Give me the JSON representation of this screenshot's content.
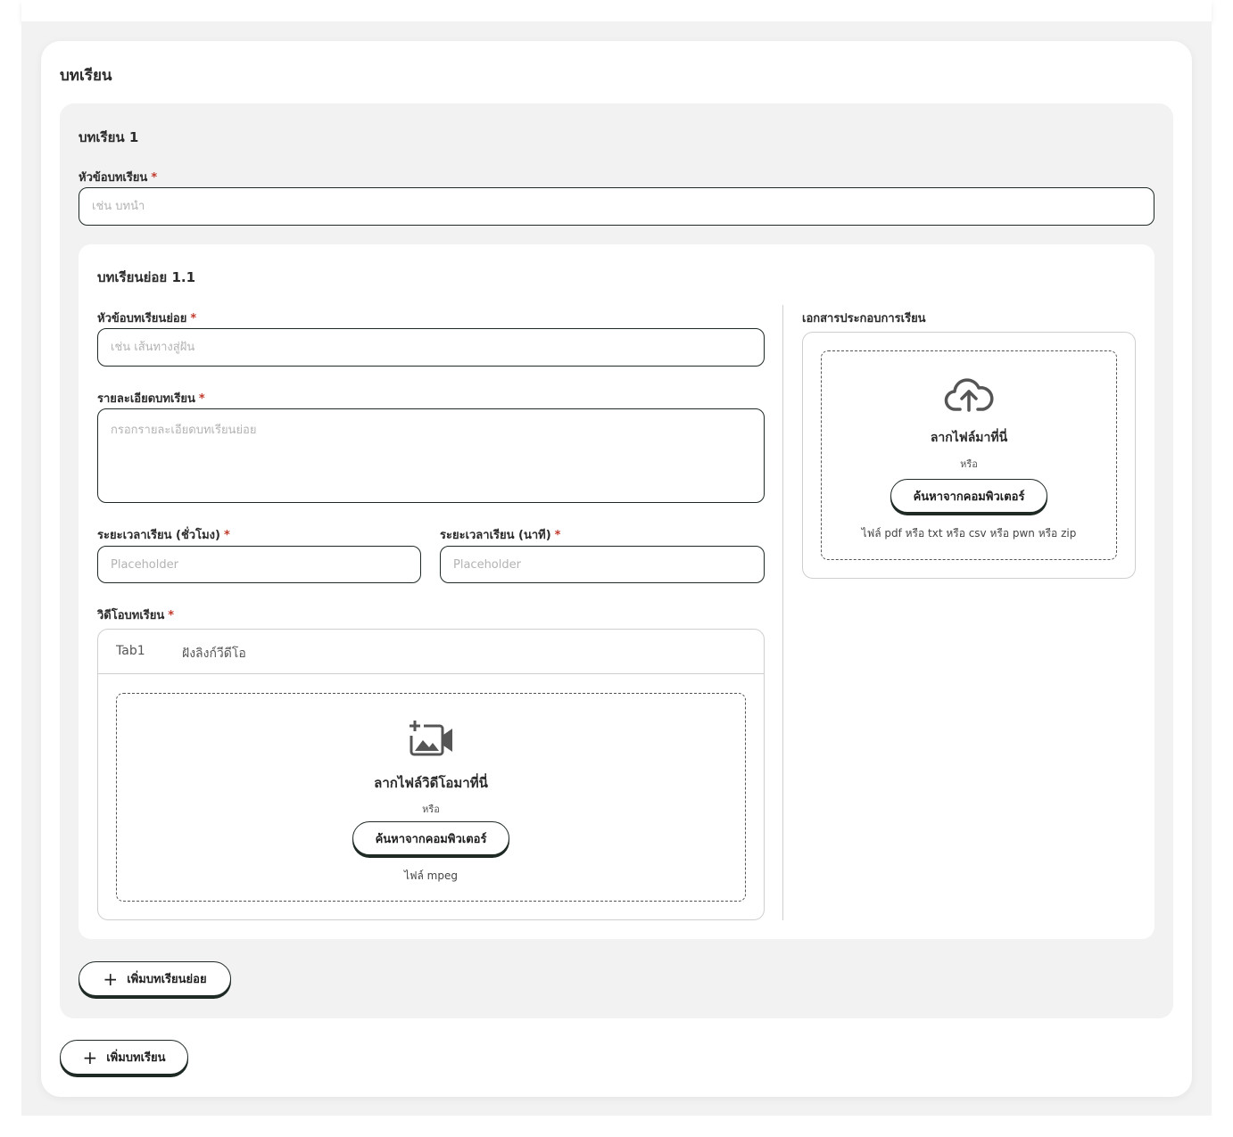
{
  "section": {
    "title": "บทเรียน"
  },
  "lesson": {
    "title": "บทเรียน 1",
    "topic_label": "หัวข้อบทเรียน",
    "topic_placeholder": "เช่น บทนำ",
    "required_mark": "*"
  },
  "sublesson": {
    "title": "บทเรียนย่อย 1.1",
    "topic_label": "หัวข้อบทเรียนย่อย",
    "topic_placeholder": "เช่น เส้นทางสู่ฝัน",
    "detail_label": "รายละเอียดบทเรียน",
    "detail_placeholder": "กรอกรายละเอียดบทเรียนย่อย",
    "hours_label": "ระยะเวลาเรียน (ชั่วโมง)",
    "hours_placeholder": "Placeholder",
    "minutes_label": "ระยะเวลาเรียน (นาที)",
    "minutes_placeholder": "Placeholder",
    "video_label": "วิดีโอบทเรียน",
    "video_tabs": [
      "Tab1",
      "ฝังลิงก์วีดีโอ"
    ],
    "video_drop": {
      "icon": "add-video-icon",
      "title": "ลากไฟล์วิดีโอมาที่นี่",
      "or": "หรือ",
      "browse_button": "ค้นหาจากคอมพิวเตอร์",
      "hint": "ไฟล์ mpeg"
    },
    "docs_label": "เอกสารประกอบการเรียน",
    "docs_drop": {
      "icon": "cloud-upload-icon",
      "title": "ลากไฟล์มาที่นี่",
      "or": "หรือ",
      "browse_button": "ค้นหาจากคอมพิวเตอร์",
      "hint": "ไฟล์ pdf หรือ txt หรือ csv หรือ pwn หรือ zip"
    }
  },
  "buttons": {
    "add_sublesson": "เพิ่มบทเรียนย่อย",
    "add_lesson": "เพิ่มบทเรียน"
  },
  "colors": {
    "accent_border": "#1f2a24",
    "required": "#c0392b",
    "panel_bg": "#f2f2f2"
  }
}
